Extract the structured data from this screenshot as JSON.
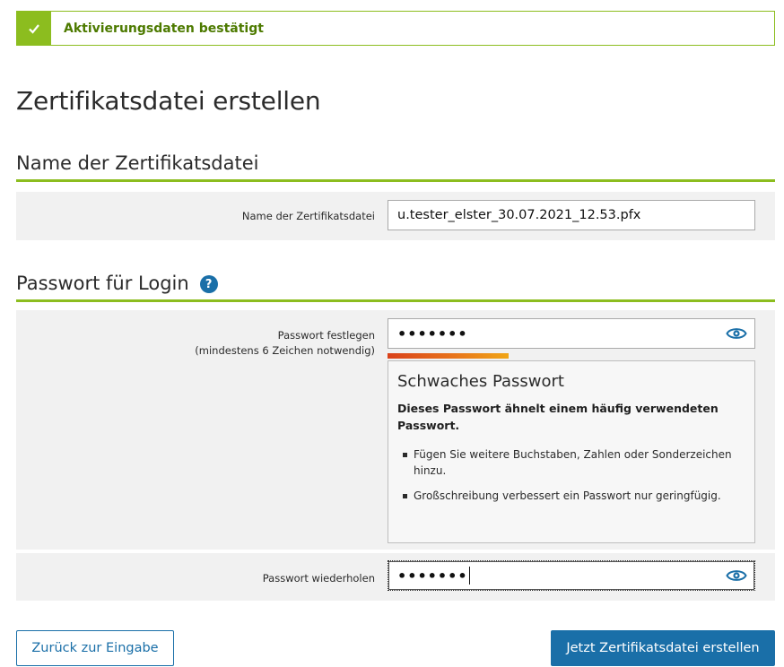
{
  "success": {
    "message": "Aktivierungsdaten bestätigt"
  },
  "page": {
    "title": "Zertifikatsdatei erstellen"
  },
  "section_filename": {
    "heading": "Name der Zertifikatsdatei",
    "label": "Name der Zertifikatsdatei",
    "value": "u.tester_elster_30.07.2021_12.53.pfx"
  },
  "section_password": {
    "heading": "Passwort für Login",
    "help_glyph": "?",
    "set_label": "Passwort festlegen",
    "set_sublabel": "(mindestens 6 Zeichen notwendig)",
    "set_value_masked": "•••••••",
    "strength": {
      "level": 0.33,
      "title": "Schwaches Passwort",
      "message": "Dieses Passwort ähnelt einem häufig verwendeten Passwort.",
      "hints": [
        "Fügen Sie weitere Buchstaben, Zahlen oder Sonderzeichen hinzu.",
        "Großschreibung verbessert ein Passwort nur geringfügig."
      ]
    },
    "repeat_label": "Passwort wiederholen",
    "repeat_value_masked": "•••••••"
  },
  "actions": {
    "back_label": "Zurück zur Eingabe",
    "create_label": "Jetzt Zertifikatsdatei erstellen"
  },
  "icons": {
    "success": "check-icon",
    "help": "help-icon",
    "reveal": "eye-icon"
  },
  "colors": {
    "accent_green": "#8cbd1f",
    "brand_blue": "#1a6fa8",
    "strength_weak": "#d9411a"
  }
}
